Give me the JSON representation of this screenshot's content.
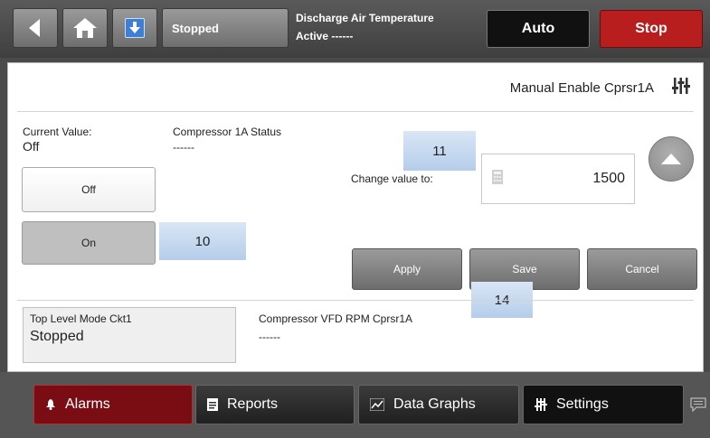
{
  "header": {
    "status_button": "Stopped",
    "point_name": "Discharge Air Temperature",
    "point_state": "Active ------",
    "auto_label": "Auto",
    "stop_label": "Stop"
  },
  "panel": {
    "title": "Manual Enable Cprsr1A",
    "current_value_label": "Current Value:",
    "current_value": "Off",
    "compressor_status_label": "Compressor 1A Status",
    "compressor_status_value": "------",
    "option_off": "Off",
    "option_on": "On",
    "change_value_label": "Change value to:",
    "change_value": "1500",
    "apply_label": "Apply",
    "save_label": "Save",
    "cancel_label": "Cancel",
    "mode_label": "Top Level Mode Ckt1",
    "mode_value": "Stopped",
    "vfd_label": "Compressor VFD RPM Cprsr1A",
    "vfd_value": "------"
  },
  "callouts": {
    "c10": "10",
    "c11": "11",
    "c14": "14"
  },
  "nav": {
    "alarms": "Alarms",
    "reports": "Reports",
    "data_graphs": "Data Graphs",
    "settings": "Settings"
  },
  "icons": {
    "back": "back-arrow-icon",
    "home": "home-icon",
    "scroll": "scroll-down-icon",
    "header": "settings-sliders-icon",
    "calc": "calculator-icon",
    "up": "chevron-up-icon",
    "bell": "bell-icon",
    "doc": "document-icon",
    "chart": "chart-icon",
    "sliders": "sliders-icon",
    "chat": "chat-icon"
  },
  "colors": {
    "stop": "#b81e1e",
    "alarms": "#7a0d13",
    "accent_blue": "#3d7fd6"
  }
}
